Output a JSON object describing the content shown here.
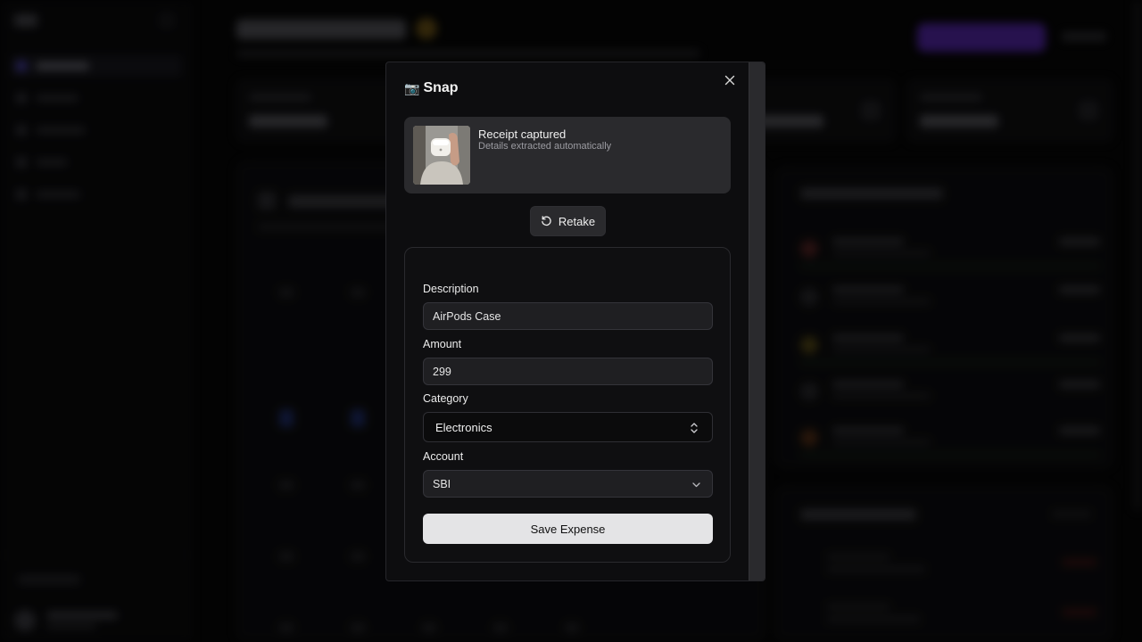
{
  "modal": {
    "title": "Snap",
    "camera_glyph": "📷",
    "close_icon": "close-icon"
  },
  "receipt": {
    "title": "Receipt captured",
    "subtitle": "Details extracted automatically"
  },
  "retake_label": "Retake",
  "form": {
    "description_label": "Description",
    "description_value": "AirPods Case",
    "amount_label": "Amount",
    "amount_value": "299",
    "category_label": "Category",
    "category_value": "Electronics",
    "account_label": "Account",
    "account_value": "SBI",
    "save_label": "Save Expense"
  },
  "colors": {
    "modal_bg": "#0d0d0f",
    "panel_bg": "#2a2a2d",
    "primary_button": "#e4e4e6",
    "accent_purple": "#6a2fd9"
  }
}
